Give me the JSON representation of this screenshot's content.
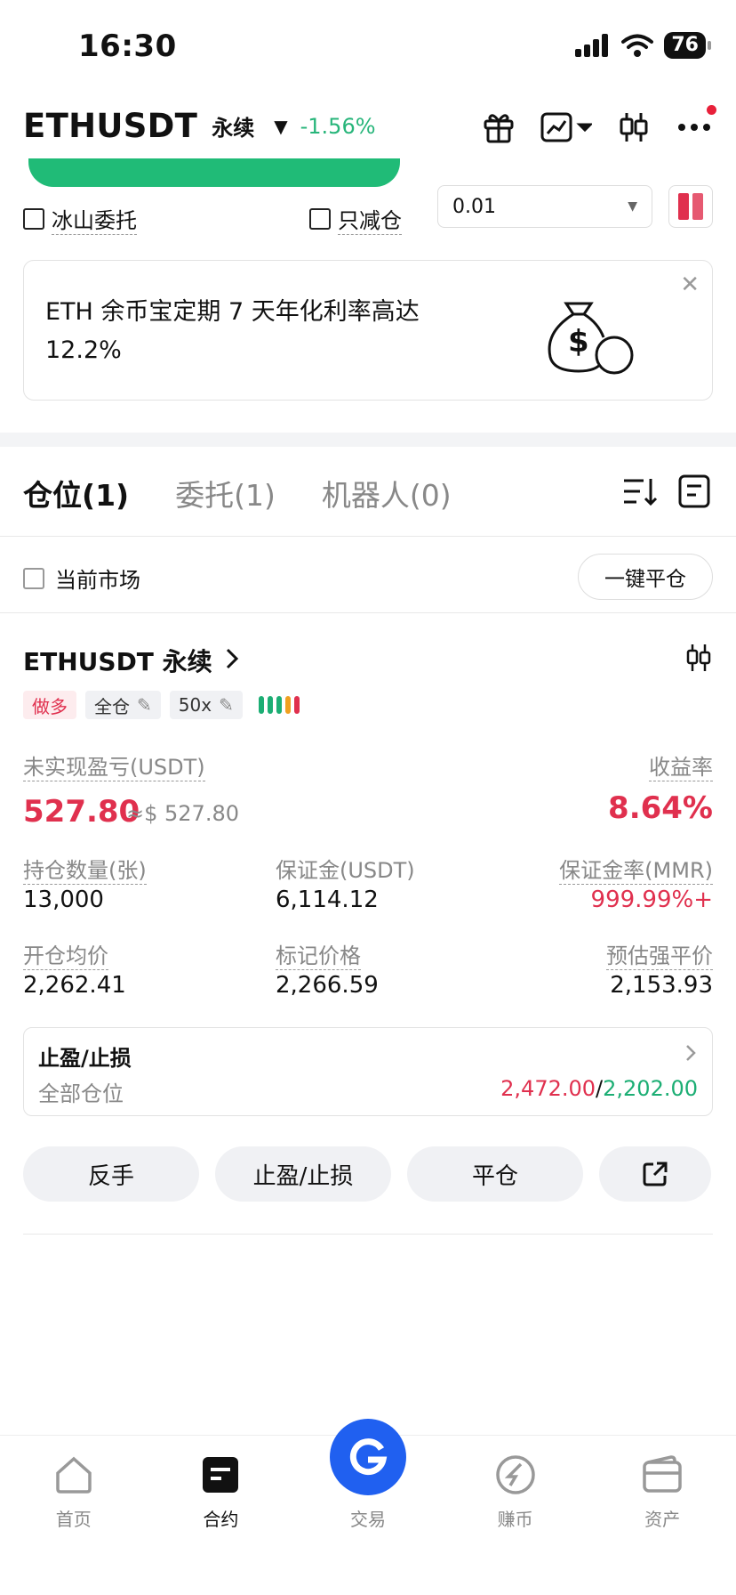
{
  "status": {
    "time": "16:30",
    "battery": "76"
  },
  "header": {
    "symbol": "ETHUSDT",
    "contract_type": "永续",
    "change": "-1.56%"
  },
  "options": {
    "iceberg": "冰山委托",
    "reduce_only": "只减仓",
    "quantity": "0.01"
  },
  "banner": {
    "text": "ETH 余币宝定期 7 天年化利率高达 12.2%"
  },
  "tabs": [
    {
      "label": "仓位(1)"
    },
    {
      "label": "委托(1)"
    },
    {
      "label": "机器人(0)"
    }
  ],
  "filter": {
    "current_market": "当前市场",
    "close_all": "一键平仓"
  },
  "position": {
    "title": "ETHUSDT 永续",
    "side": "做多",
    "margin_mode": "全仓",
    "leverage": "50x",
    "pnl_label": "未实现盈亏(USDT)",
    "pnl": "527.80",
    "pnl_usd": "≈$ 527.80",
    "roe_label": "收益率",
    "roe": "8.64%",
    "size_label": "持仓数量(张)",
    "size": "13,000",
    "margin_label": "保证金(USDT)",
    "margin": "6,114.12",
    "mmr_label": "保证金率(MMR)",
    "mmr": "999.99%+",
    "entry_label": "开仓均价",
    "entry": "2,262.41",
    "mark_label": "标记价格",
    "mark": "2,266.59",
    "liq_label": "预估强平价",
    "liq": "2,153.93",
    "tpsl_title": "止盈/止损",
    "tpsl_scope": "全部仓位",
    "tp": "2,472.00",
    "sl": "2,202.00"
  },
  "actions": {
    "reverse": "反手",
    "tpsl": "止盈/止损",
    "close": "平仓"
  },
  "nav": [
    {
      "label": "首页"
    },
    {
      "label": "合约"
    },
    {
      "label": "交易"
    },
    {
      "label": "赚币"
    },
    {
      "label": "资产"
    }
  ],
  "colors": {
    "up": "#1cae74",
    "down": "#e0304e",
    "accent": "#2060f0"
  }
}
